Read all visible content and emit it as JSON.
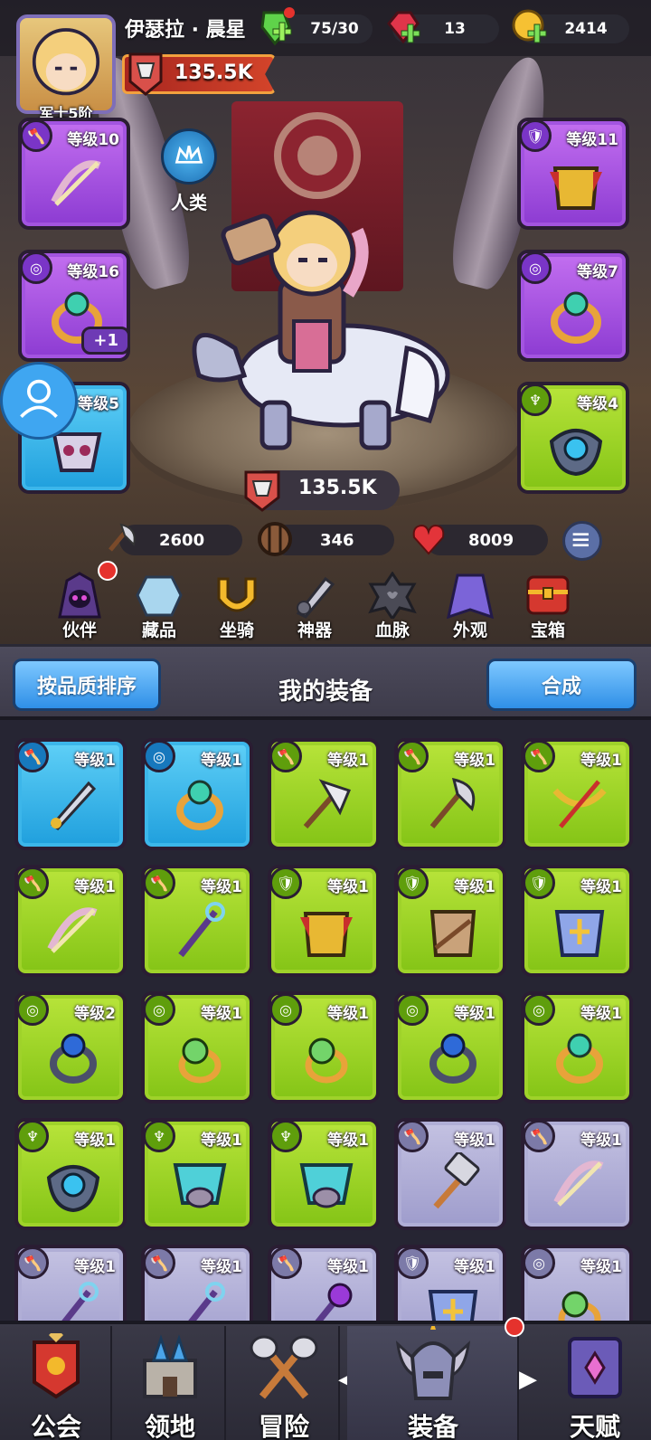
{
  "header": {
    "player_name": "伊瑟拉 · 晨星",
    "rank": "军士5阶",
    "stamina": "75/30",
    "gems": "13",
    "gold": "2414"
  },
  "hero": {
    "power": "135.5K",
    "race": "人类",
    "power_center": "135.5K",
    "attack": "2600",
    "defense": "346",
    "hp": "8009"
  },
  "equipped": [
    {
      "level": "等级10",
      "rarity": "purple",
      "slot": "weapon",
      "item": "bow"
    },
    {
      "level": "等级11",
      "rarity": "purple",
      "slot": "armor",
      "item": "chestplate"
    },
    {
      "level": "等级16",
      "rarity": "purple",
      "slot": "ring",
      "item": "ring",
      "extra": "+1"
    },
    {
      "level": "等级7",
      "rarity": "purple",
      "slot": "ring",
      "item": "ring"
    },
    {
      "level": "等级5",
      "rarity": "blue",
      "slot": "helmet",
      "item": "mask"
    },
    {
      "level": "等级4",
      "rarity": "green",
      "slot": "amulet",
      "item": "amulet"
    }
  ],
  "menu": [
    {
      "label": "伙伴",
      "icon": "hooded-companion-icon",
      "dot": true
    },
    {
      "label": "藏品",
      "icon": "crystal-icon",
      "dot": false
    },
    {
      "label": "坐骑",
      "icon": "horseshoe-icon",
      "dot": false
    },
    {
      "label": "神器",
      "icon": "artifact-blade-icon",
      "dot": false
    },
    {
      "label": "血脉",
      "icon": "bloodline-emblem-icon",
      "dot": false
    },
    {
      "label": "外观",
      "icon": "cape-icon",
      "dot": false
    },
    {
      "label": "宝箱",
      "icon": "treasure-chest-icon",
      "dot": false
    }
  ],
  "panel": {
    "sort_label": "按品质排序",
    "title": "我的装备",
    "combine_label": "合成"
  },
  "inventory": [
    {
      "level": "等级1",
      "rarity": "blue",
      "slot": "weapon",
      "item": "dagger"
    },
    {
      "level": "等级1",
      "rarity": "blue",
      "slot": "ring",
      "item": "ring"
    },
    {
      "level": "等级1",
      "rarity": "green",
      "slot": "weapon",
      "item": "cleaver"
    },
    {
      "level": "等级1",
      "rarity": "green",
      "slot": "weapon",
      "item": "axe"
    },
    {
      "level": "等级1",
      "rarity": "green",
      "slot": "weapon",
      "item": "crossbow"
    },
    {
      "level": "等级1",
      "rarity": "green",
      "slot": "weapon",
      "item": "bow"
    },
    {
      "level": "等级1",
      "rarity": "green",
      "slot": "weapon",
      "item": "staff"
    },
    {
      "level": "等级1",
      "rarity": "green",
      "slot": "armor",
      "item": "chestplate"
    },
    {
      "level": "等级1",
      "rarity": "green",
      "slot": "armor",
      "item": "tunic"
    },
    {
      "level": "等级1",
      "rarity": "green",
      "slot": "armor",
      "item": "plate-armor"
    },
    {
      "level": "等级2",
      "rarity": "green",
      "slot": "ring",
      "item": "dark-ring"
    },
    {
      "level": "等级1",
      "rarity": "green",
      "slot": "ring",
      "item": "orb-ring"
    },
    {
      "level": "等级1",
      "rarity": "green",
      "slot": "ring",
      "item": "orb-ring"
    },
    {
      "level": "等级1",
      "rarity": "green",
      "slot": "ring",
      "item": "dark-ring"
    },
    {
      "level": "等级1",
      "rarity": "green",
      "slot": "ring",
      "item": "ring"
    },
    {
      "level": "等级1",
      "rarity": "green",
      "slot": "amulet",
      "item": "amulet"
    },
    {
      "level": "等级1",
      "rarity": "green",
      "slot": "amulet",
      "item": "mask"
    },
    {
      "level": "等级1",
      "rarity": "green",
      "slot": "amulet",
      "item": "mask"
    },
    {
      "level": "等级1",
      "rarity": "gray",
      "slot": "weapon",
      "item": "hammer"
    },
    {
      "level": "等级1",
      "rarity": "gray",
      "slot": "weapon",
      "item": "bow"
    },
    {
      "level": "等级1",
      "rarity": "gray",
      "slot": "weapon",
      "item": "staff"
    },
    {
      "level": "等级1",
      "rarity": "gray",
      "slot": "weapon",
      "item": "staff"
    },
    {
      "level": "等级1",
      "rarity": "gray",
      "slot": "weapon",
      "item": "orb-staff"
    },
    {
      "level": "等级1",
      "rarity": "gray",
      "slot": "armor",
      "item": "plate-armor"
    },
    {
      "level": "等级1",
      "rarity": "gray",
      "slot": "ring",
      "item": "orb-ring"
    }
  ],
  "nav": [
    {
      "label": "公会",
      "icon": "guild-banner-icon",
      "active": false
    },
    {
      "label": "领地",
      "icon": "castle-icon",
      "active": false
    },
    {
      "label": "冒险",
      "icon": "crossed-axes-icon",
      "active": false
    },
    {
      "label": "装备",
      "icon": "horned-helmet-icon",
      "active": true,
      "dot": true
    },
    {
      "label": "天赋",
      "icon": "talent-book-icon",
      "active": false
    }
  ],
  "colors": {
    "purple": "#a354e0",
    "green": "#9fd22a",
    "blue": "#3cb6ea",
    "gray": "#b0aed6",
    "notification": "#e5322d"
  }
}
